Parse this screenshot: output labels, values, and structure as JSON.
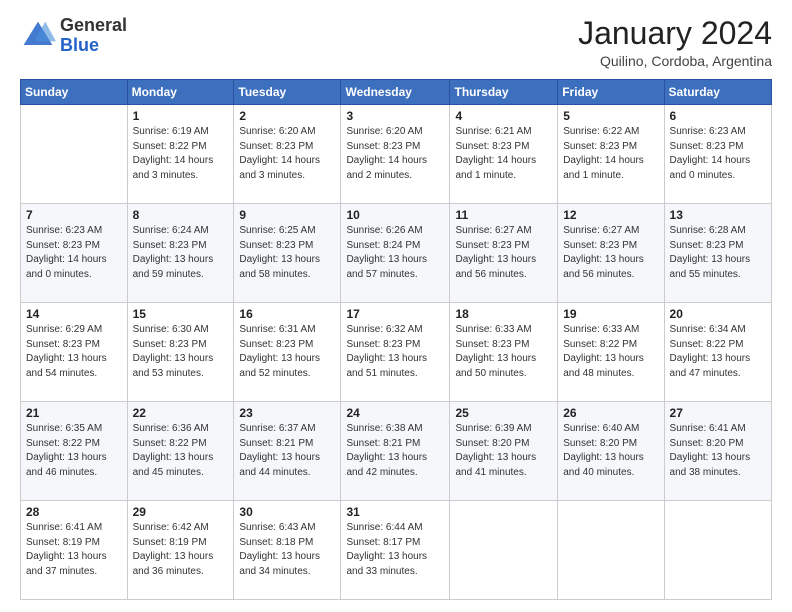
{
  "header": {
    "logo_general": "General",
    "logo_blue": "Blue",
    "month_title": "January 2024",
    "location": "Quilino, Cordoba, Argentina"
  },
  "weekdays": [
    "Sunday",
    "Monday",
    "Tuesday",
    "Wednesday",
    "Thursday",
    "Friday",
    "Saturday"
  ],
  "weeks": [
    [
      {
        "num": "",
        "info": ""
      },
      {
        "num": "1",
        "info": "Sunrise: 6:19 AM\nSunset: 8:22 PM\nDaylight: 14 hours\nand 3 minutes."
      },
      {
        "num": "2",
        "info": "Sunrise: 6:20 AM\nSunset: 8:23 PM\nDaylight: 14 hours\nand 3 minutes."
      },
      {
        "num": "3",
        "info": "Sunrise: 6:20 AM\nSunset: 8:23 PM\nDaylight: 14 hours\nand 2 minutes."
      },
      {
        "num": "4",
        "info": "Sunrise: 6:21 AM\nSunset: 8:23 PM\nDaylight: 14 hours\nand 1 minute."
      },
      {
        "num": "5",
        "info": "Sunrise: 6:22 AM\nSunset: 8:23 PM\nDaylight: 14 hours\nand 1 minute."
      },
      {
        "num": "6",
        "info": "Sunrise: 6:23 AM\nSunset: 8:23 PM\nDaylight: 14 hours\nand 0 minutes."
      }
    ],
    [
      {
        "num": "7",
        "info": "Sunrise: 6:23 AM\nSunset: 8:23 PM\nDaylight: 14 hours\nand 0 minutes."
      },
      {
        "num": "8",
        "info": "Sunrise: 6:24 AM\nSunset: 8:23 PM\nDaylight: 13 hours\nand 59 minutes."
      },
      {
        "num": "9",
        "info": "Sunrise: 6:25 AM\nSunset: 8:23 PM\nDaylight: 13 hours\nand 58 minutes."
      },
      {
        "num": "10",
        "info": "Sunrise: 6:26 AM\nSunset: 8:24 PM\nDaylight: 13 hours\nand 57 minutes."
      },
      {
        "num": "11",
        "info": "Sunrise: 6:27 AM\nSunset: 8:23 PM\nDaylight: 13 hours\nand 56 minutes."
      },
      {
        "num": "12",
        "info": "Sunrise: 6:27 AM\nSunset: 8:23 PM\nDaylight: 13 hours\nand 56 minutes."
      },
      {
        "num": "13",
        "info": "Sunrise: 6:28 AM\nSunset: 8:23 PM\nDaylight: 13 hours\nand 55 minutes."
      }
    ],
    [
      {
        "num": "14",
        "info": "Sunrise: 6:29 AM\nSunset: 8:23 PM\nDaylight: 13 hours\nand 54 minutes."
      },
      {
        "num": "15",
        "info": "Sunrise: 6:30 AM\nSunset: 8:23 PM\nDaylight: 13 hours\nand 53 minutes."
      },
      {
        "num": "16",
        "info": "Sunrise: 6:31 AM\nSunset: 8:23 PM\nDaylight: 13 hours\nand 52 minutes."
      },
      {
        "num": "17",
        "info": "Sunrise: 6:32 AM\nSunset: 8:23 PM\nDaylight: 13 hours\nand 51 minutes."
      },
      {
        "num": "18",
        "info": "Sunrise: 6:33 AM\nSunset: 8:23 PM\nDaylight: 13 hours\nand 50 minutes."
      },
      {
        "num": "19",
        "info": "Sunrise: 6:33 AM\nSunset: 8:22 PM\nDaylight: 13 hours\nand 48 minutes."
      },
      {
        "num": "20",
        "info": "Sunrise: 6:34 AM\nSunset: 8:22 PM\nDaylight: 13 hours\nand 47 minutes."
      }
    ],
    [
      {
        "num": "21",
        "info": "Sunrise: 6:35 AM\nSunset: 8:22 PM\nDaylight: 13 hours\nand 46 minutes."
      },
      {
        "num": "22",
        "info": "Sunrise: 6:36 AM\nSunset: 8:22 PM\nDaylight: 13 hours\nand 45 minutes."
      },
      {
        "num": "23",
        "info": "Sunrise: 6:37 AM\nSunset: 8:21 PM\nDaylight: 13 hours\nand 44 minutes."
      },
      {
        "num": "24",
        "info": "Sunrise: 6:38 AM\nSunset: 8:21 PM\nDaylight: 13 hours\nand 42 minutes."
      },
      {
        "num": "25",
        "info": "Sunrise: 6:39 AM\nSunset: 8:20 PM\nDaylight: 13 hours\nand 41 minutes."
      },
      {
        "num": "26",
        "info": "Sunrise: 6:40 AM\nSunset: 8:20 PM\nDaylight: 13 hours\nand 40 minutes."
      },
      {
        "num": "27",
        "info": "Sunrise: 6:41 AM\nSunset: 8:20 PM\nDaylight: 13 hours\nand 38 minutes."
      }
    ],
    [
      {
        "num": "28",
        "info": "Sunrise: 6:41 AM\nSunset: 8:19 PM\nDaylight: 13 hours\nand 37 minutes."
      },
      {
        "num": "29",
        "info": "Sunrise: 6:42 AM\nSunset: 8:19 PM\nDaylight: 13 hours\nand 36 minutes."
      },
      {
        "num": "30",
        "info": "Sunrise: 6:43 AM\nSunset: 8:18 PM\nDaylight: 13 hours\nand 34 minutes."
      },
      {
        "num": "31",
        "info": "Sunrise: 6:44 AM\nSunset: 8:17 PM\nDaylight: 13 hours\nand 33 minutes."
      },
      {
        "num": "",
        "info": ""
      },
      {
        "num": "",
        "info": ""
      },
      {
        "num": "",
        "info": ""
      }
    ]
  ]
}
